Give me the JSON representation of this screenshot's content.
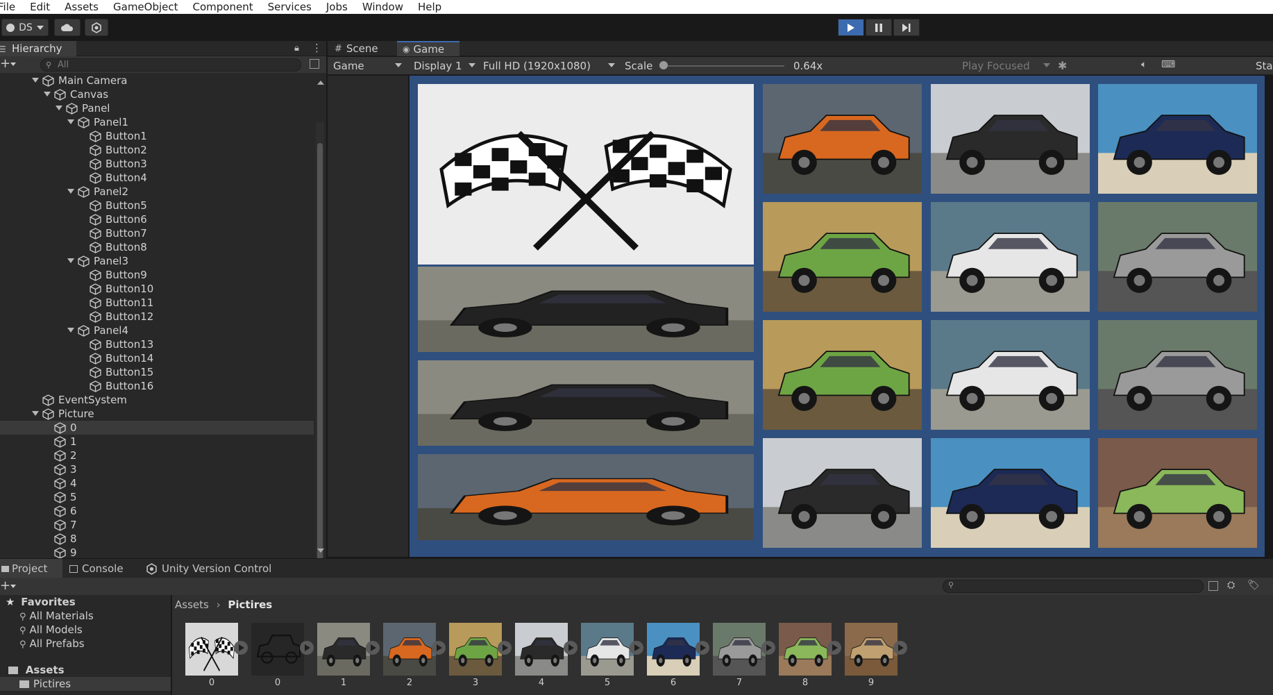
{
  "menu": [
    "File",
    "Edit",
    "Assets",
    "GameObject",
    "Component",
    "Services",
    "Jobs",
    "Window",
    "Help"
  ],
  "toolbar": {
    "account": "DS",
    "play_icon": "play-icon",
    "pause_icon": "pause-icon",
    "step_icon": "step-icon"
  },
  "hierarchy": {
    "tab_label": "Hierarchy",
    "search_placeholder": "All",
    "rows": [
      {
        "label": "Main Camera",
        "depth": 1,
        "expanded": true
      },
      {
        "label": "Canvas",
        "depth": 2,
        "expanded": true
      },
      {
        "label": "Panel",
        "depth": 3,
        "expanded": true
      },
      {
        "label": "Panel1",
        "depth": 4,
        "expanded": true
      },
      {
        "label": "Button1",
        "depth": 5
      },
      {
        "label": "Button2",
        "depth": 5
      },
      {
        "label": "Button3",
        "depth": 5
      },
      {
        "label": "Button4",
        "depth": 5
      },
      {
        "label": "Panel2",
        "depth": 4,
        "expanded": true
      },
      {
        "label": "Button5",
        "depth": 5
      },
      {
        "label": "Button6",
        "depth": 5
      },
      {
        "label": "Button7",
        "depth": 5
      },
      {
        "label": "Button8",
        "depth": 5
      },
      {
        "label": "Panel3",
        "depth": 4,
        "expanded": true
      },
      {
        "label": "Button9",
        "depth": 5
      },
      {
        "label": "Button10",
        "depth": 5
      },
      {
        "label": "Button11",
        "depth": 5
      },
      {
        "label": "Button12",
        "depth": 5
      },
      {
        "label": "Panel4",
        "depth": 4,
        "expanded": true
      },
      {
        "label": "Button13",
        "depth": 5
      },
      {
        "label": "Button14",
        "depth": 5
      },
      {
        "label": "Button15",
        "depth": 5
      },
      {
        "label": "Button16",
        "depth": 5
      },
      {
        "label": "EventSystem",
        "depth": 1
      },
      {
        "label": "Picture",
        "depth": 1,
        "expanded": true
      },
      {
        "label": "0",
        "depth": 2,
        "selected": true
      },
      {
        "label": "1",
        "depth": 2
      },
      {
        "label": "2",
        "depth": 2
      },
      {
        "label": "3",
        "depth": 2
      },
      {
        "label": "4",
        "depth": 2
      },
      {
        "label": "5",
        "depth": 2
      },
      {
        "label": "6",
        "depth": 2
      },
      {
        "label": "7",
        "depth": 2
      },
      {
        "label": "8",
        "depth": 2
      },
      {
        "label": "9",
        "depth": 2
      }
    ]
  },
  "view_tabs": {
    "scene": "Scene",
    "game": "Game"
  },
  "game_bar": {
    "mode": "Game",
    "display": "Display 1",
    "resolution": "Full HD (1920x1080)",
    "scale_label": "Scale",
    "scale_value": "0.64x",
    "scale_fraction": 0.0,
    "play_focused": "Play Focused",
    "stats": "Stat"
  },
  "game_tiles": [
    {
      "id": "flags",
      "kind": "flags"
    },
    {
      "id": "orange-truck",
      "kind": "car",
      "color": "#d8681f",
      "sky": "#5b6670",
      "ground": "#4a4a44"
    },
    {
      "id": "black-jeep-1",
      "kind": "car",
      "color": "#2a2a2a",
      "sky": "#c9ccd0",
      "ground": "#8a8a88"
    },
    {
      "id": "blue-suv-1",
      "kind": "car",
      "color": "#1c2a55",
      "sky": "#4a90c0",
      "ground": "#d9cfb8"
    },
    {
      "id": "green-jeep-1",
      "kind": "car",
      "color": "#6ea544",
      "sky": "#b89a5a",
      "ground": "#6b5a3e"
    },
    {
      "id": "white-suv-1",
      "kind": "car",
      "color": "#e6e6e6",
      "sky": "#5a7a8a",
      "ground": "#9a9a90"
    },
    {
      "id": "silver-suv-1",
      "kind": "car",
      "color": "#9a9a9a",
      "sky": "#6a7a6a",
      "ground": "#555555"
    },
    {
      "id": "jeep-stretched-1",
      "kind": "car",
      "color": "#222222",
      "sky": "#8a8a80",
      "ground": "#6a6a60"
    },
    {
      "id": "green-jeep-2",
      "kind": "car",
      "color": "#6ea544",
      "sky": "#b89a5a",
      "ground": "#6b5a3e"
    },
    {
      "id": "white-suv-2",
      "kind": "car",
      "color": "#e6e6e6",
      "sky": "#5a7a8a",
      "ground": "#9a9a90"
    },
    {
      "id": "silver-suv-2",
      "kind": "car",
      "color": "#9a9a9a",
      "sky": "#6a7a6a",
      "ground": "#555555"
    },
    {
      "id": "jeep-stretched-2",
      "kind": "car",
      "color": "#222222",
      "sky": "#8a8a80",
      "ground": "#6a6a60"
    },
    {
      "id": "orange-stretched",
      "kind": "car",
      "color": "#d8681f",
      "sky": "#5b6670",
      "ground": "#4a4a44"
    },
    {
      "id": "black-jeep-2",
      "kind": "car",
      "color": "#2a2a2a",
      "sky": "#c9ccd0",
      "ground": "#8a8a88"
    },
    {
      "id": "blue-suv-2",
      "kind": "car",
      "color": "#1c2a55",
      "sky": "#4a90c0",
      "ground": "#d9cfb8"
    },
    {
      "id": "green-wagoneer",
      "kind": "car",
      "color": "#8ab85a",
      "sky": "#7a5a4a",
      "ground": "#9a7a5a"
    }
  ],
  "bottom_tabs": {
    "project": "Project",
    "console": "Console",
    "vcs": "Unity Version Control"
  },
  "project": {
    "favorites_label": "Favorites",
    "favorites": [
      "All Materials",
      "All Models",
      "All Prefabs"
    ],
    "assets_label": "Assets",
    "folders": [
      "Pictires"
    ],
    "breadcrumb_root": "Assets",
    "breadcrumb_current": "Pictires",
    "assets": [
      {
        "label": "0",
        "kind": "flags"
      },
      {
        "label": "0",
        "kind": "outline",
        "color": "#ffffff"
      },
      {
        "label": "1",
        "kind": "car",
        "color": "#2a2a2a",
        "sky": "#8a8a80",
        "ground": "#6a6a60"
      },
      {
        "label": "2",
        "kind": "car",
        "color": "#d8681f",
        "sky": "#5b6670",
        "ground": "#4a4a44"
      },
      {
        "label": "3",
        "kind": "car",
        "color": "#6ea544",
        "sky": "#b89a5a",
        "ground": "#6b5a3e"
      },
      {
        "label": "4",
        "kind": "car",
        "color": "#2a2a2a",
        "sky": "#c9ccd0",
        "ground": "#8a8a88"
      },
      {
        "label": "5",
        "kind": "car",
        "color": "#e6e6e6",
        "sky": "#5a7a8a",
        "ground": "#9a9a90"
      },
      {
        "label": "6",
        "kind": "car",
        "color": "#1c2a55",
        "sky": "#4a90c0",
        "ground": "#d9cfb8"
      },
      {
        "label": "7",
        "kind": "car",
        "color": "#9a9a9a",
        "sky": "#6a7a6a",
        "ground": "#555555"
      },
      {
        "label": "8",
        "kind": "car",
        "color": "#8ab85a",
        "sky": "#7a5a4a",
        "ground": "#9a7a5a"
      },
      {
        "label": "9",
        "kind": "car",
        "color": "#c0a070",
        "sky": "#8a6a4a",
        "ground": "#7a5a3a"
      }
    ]
  },
  "colors": {
    "accent": "#3d6bb0",
    "game_bg": "#2f4f7f",
    "panel": "#282828"
  }
}
